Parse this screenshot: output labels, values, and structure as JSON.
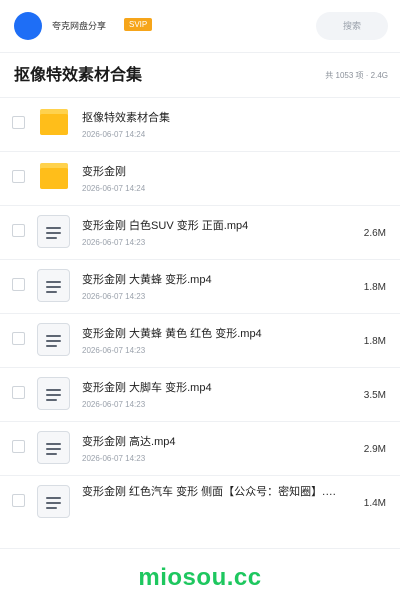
{
  "header": {
    "share_name": "夸克网盘分享",
    "badge": "SVIP",
    "search_label": "搜索",
    "avatar_color": "#1e6ef6"
  },
  "folder": {
    "title": "抠像特效素材合集",
    "summary": "共 1053 项 · 2.4G"
  },
  "files": [
    {
      "type": "folder",
      "name": "抠像特效素材合集",
      "date": "2026-06-07 14:24",
      "size": ""
    },
    {
      "type": "folder",
      "name": "变形金刚",
      "date": "2026-06-07 14:24",
      "size": ""
    },
    {
      "type": "video",
      "name": "变形金刚 白色SUV 变形 正面.mp4",
      "date": "2026-06-07 14:23",
      "size": "2.6M"
    },
    {
      "type": "video",
      "name": "变形金刚 大黄蜂 变形.mp4",
      "date": "2026-06-07 14:23",
      "size": "1.8M"
    },
    {
      "type": "video",
      "name": "变形金刚 大黄蜂 黄色 红色 变形.mp4",
      "date": "2026-06-07 14:23",
      "size": "1.8M"
    },
    {
      "type": "video",
      "name": "变形金刚 大脚车 变形.mp4",
      "date": "2026-06-07 14:23",
      "size": "3.5M"
    },
    {
      "type": "video",
      "name": "变形金刚 高达.mp4",
      "date": "2026-06-07 14:23",
      "size": "2.9M"
    },
    {
      "type": "video",
      "name": "变形金刚 红色汽车 变形 侧面【公众号：密知圈】.…",
      "date": "2026-06-07 14:23",
      "size": "1.4M"
    }
  ],
  "footer": {
    "watermark": "miosou.cc",
    "watermark_color": "#1ec75f"
  }
}
